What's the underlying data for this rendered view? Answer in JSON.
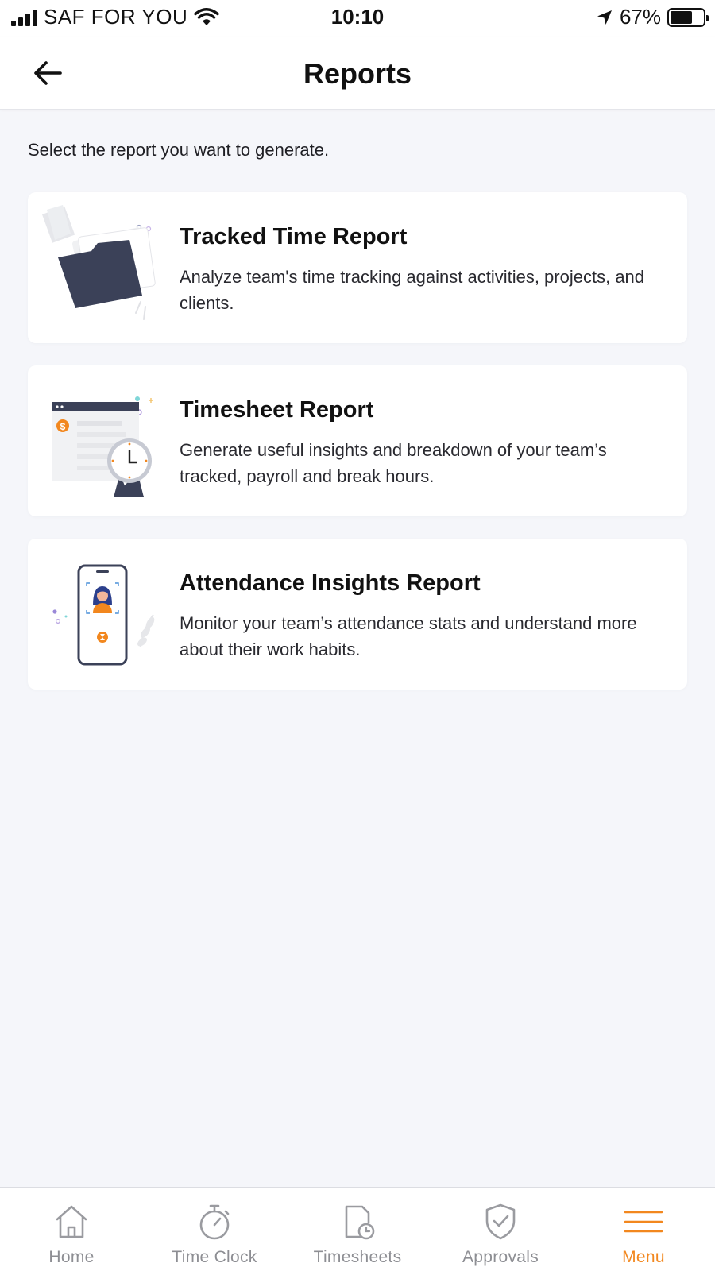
{
  "status_bar": {
    "carrier": "SAF FOR YOU",
    "time": "10:10",
    "battery_percent": "67%",
    "battery_level": 0.67
  },
  "header": {
    "title": "Reports",
    "back_icon": "arrow-left-icon"
  },
  "main": {
    "instruction": "Select the report you want to generate.",
    "reports": [
      {
        "title": "Tracked Time Report",
        "description": "Analyze team's time tracking against activities, projects, and clients.",
        "illustration": "folder-illustration"
      },
      {
        "title": "Timesheet Report",
        "description": "Generate useful insights and breakdown of your team’s tracked, payroll and break hours.",
        "illustration": "timesheet-clock-illustration"
      },
      {
        "title": "Attendance Insights Report",
        "description": "Monitor your team’s attendance stats and understand more about their work habits.",
        "illustration": "phone-person-illustration"
      }
    ]
  },
  "tab_bar": {
    "tabs": [
      {
        "label": "Home",
        "icon": "home-icon",
        "active": false
      },
      {
        "label": "Time Clock",
        "icon": "stopwatch-icon",
        "active": false
      },
      {
        "label": "Timesheets",
        "icon": "timesheet-icon",
        "active": false
      },
      {
        "label": "Approvals",
        "icon": "shield-check-icon",
        "active": false
      },
      {
        "label": "Menu",
        "icon": "hamburger-menu-icon",
        "active": true
      }
    ]
  },
  "colors": {
    "accent": "#f2871e",
    "background": "#f5f6fa",
    "card": "#ffffff",
    "illustration_navy": "#3b4158",
    "tab_inactive": "#8d8e93"
  }
}
